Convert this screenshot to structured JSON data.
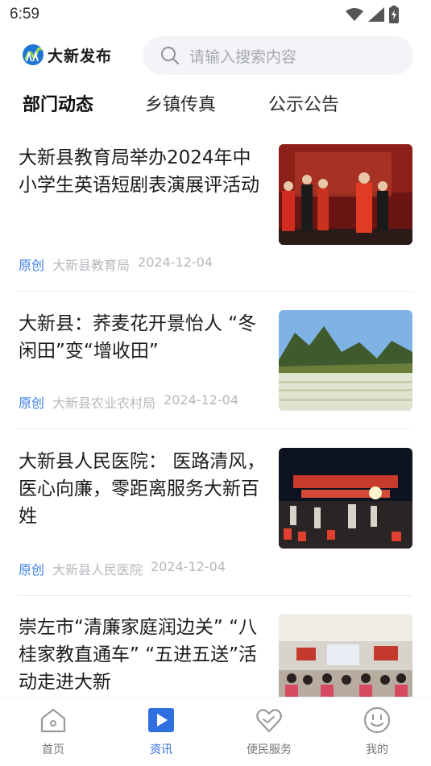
{
  "status_bar": {
    "time": "6:59"
  },
  "header": {
    "logo_text": "大新发布",
    "search_placeholder": "请输入搜索内容"
  },
  "tabs": [
    {
      "label": "部门动态",
      "active": true
    },
    {
      "label": "乡镇传真",
      "active": false
    },
    {
      "label": "公示公告",
      "active": false
    }
  ],
  "articles": [
    {
      "title": "大新县教育局举办2024年中小学生英语短剧表演展评活动",
      "tag": "原创",
      "source": "大新县教育局",
      "date": "2024-12-04"
    },
    {
      "title": "大新县：荞麦花开景怡人 “冬闲田”变“增收田”",
      "tag": "原创",
      "source": "大新县农业农村局",
      "date": "2024-12-04"
    },
    {
      "title": "大新县人民医院： 医路清风，医心向廉，零距离服务大新百姓",
      "tag": "原创",
      "source": "大新县人民医院",
      "date": "2024-12-04"
    },
    {
      "title": "崇左市“清廉家庭润边关” “八桂家教直通车” “五进五送”活动走进大新",
      "tag": "",
      "source": "",
      "date": ""
    }
  ],
  "bottom_nav": [
    {
      "label": "首页",
      "icon": "home-icon",
      "active": false
    },
    {
      "label": "资讯",
      "icon": "play-icon",
      "active": true
    },
    {
      "label": "便民服务",
      "icon": "heart-hands-icon",
      "active": false
    },
    {
      "label": "我的",
      "icon": "smile-icon",
      "active": false
    }
  ],
  "colors": {
    "accent": "#2f6fe0",
    "tag": "#3d7fe6",
    "meta": "#b5b8bd",
    "search_bg": "#f3f4f8"
  }
}
